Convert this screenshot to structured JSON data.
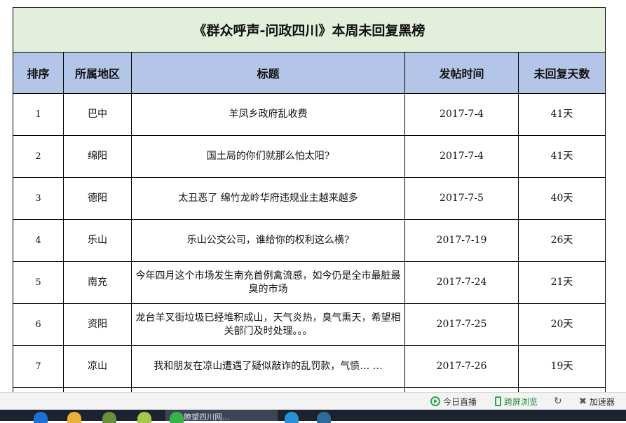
{
  "sheet": {
    "title": "《群众呼声-问政四川》本周未回复黑榜",
    "headers": [
      "排序",
      "所属地区",
      "标题",
      "发帖时间",
      "未回复天数"
    ],
    "rows": [
      {
        "rank": "1",
        "region": "巴中",
        "title": "羊凤乡政府乱收费",
        "date": "2017-7-4",
        "days": "41天"
      },
      {
        "rank": "2",
        "region": "绵阳",
        "title": "国土局的你们就那么怕太阳?",
        "date": "2017-7-4",
        "days": "41天"
      },
      {
        "rank": "3",
        "region": "德阳",
        "title": "太丑恶了 绵竹龙岭华府违规业主越来越多",
        "date": "2017-7-5",
        "days": "40天"
      },
      {
        "rank": "4",
        "region": "乐山",
        "title": "乐山公交公司，谁给你的权利这么横?",
        "date": "2017-7-19",
        "days": "26天"
      },
      {
        "rank": "5",
        "region": "南充",
        "title": "今年四月这个市场发生南充首例禽流感，如今仍是全市最脏最臭的市场",
        "date": "2017-7-24",
        "days": "21天"
      },
      {
        "rank": "6",
        "region": "资阳",
        "title": "龙台羊叉街垃圾已经堆积成山，天气炎热，臭气熏天，希望相关部门及时处理。。。",
        "date": "2017-7-25",
        "days": "20天"
      },
      {
        "rank": "7",
        "region": "凉山",
        "title": "我和朋友在凉山遭遇了疑似敲诈的乱罚款，气愤… …",
        "date": "2017-7-26",
        "days": "19天"
      }
    ]
  },
  "statusbar": {
    "live_label": "今日直播",
    "cross_screen_label": "跨屏浏览",
    "accelerator_label": "加速器"
  },
  "taskbar": {
    "active_label": "瞭望四川网..."
  },
  "colors": {
    "title_bg": "#e3eedb",
    "header_bg": "#b4c6e7",
    "accent_green": "#2aa84a"
  }
}
